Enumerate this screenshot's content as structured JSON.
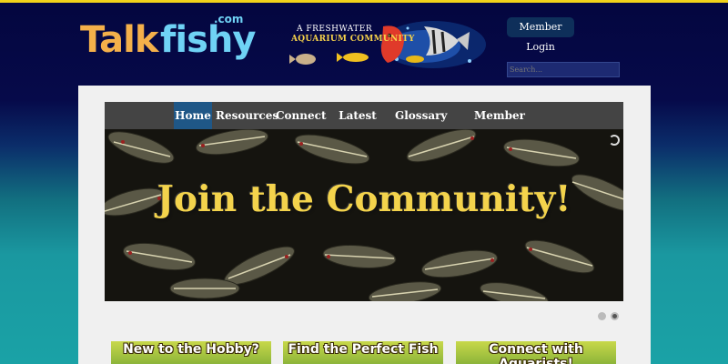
{
  "site": {
    "logo_talk": "Talk",
    "logo_fishy": "fishy",
    "logo_com": ".com"
  },
  "banner": {
    "line1": "A FRESHWATER",
    "line2": "AQUARIUM COMMUNITY"
  },
  "header": {
    "login_label": "Member Login",
    "search_placeholder": "Search..."
  },
  "nav": {
    "items": [
      {
        "label": "Home",
        "active": true
      },
      {
        "label": "Resources"
      },
      {
        "label": "Connect"
      },
      {
        "label": "Latest Word"
      },
      {
        "label": "Glossary"
      },
      {
        "label": "Member Downloads"
      }
    ]
  },
  "slider": {
    "title": "Join the Community!",
    "slide_count": 2,
    "active_slide": 2
  },
  "cards": [
    {
      "label": "New to the Hobby?"
    },
    {
      "label": "Find the Perfect Fish"
    },
    {
      "label": "Connect with Aquarists!"
    }
  ],
  "colors": {
    "accent_yellow": "#f2d21a",
    "nav_active": "#1f5787",
    "logo_orange": "#f4b04a",
    "logo_blue": "#6fd2f5"
  }
}
